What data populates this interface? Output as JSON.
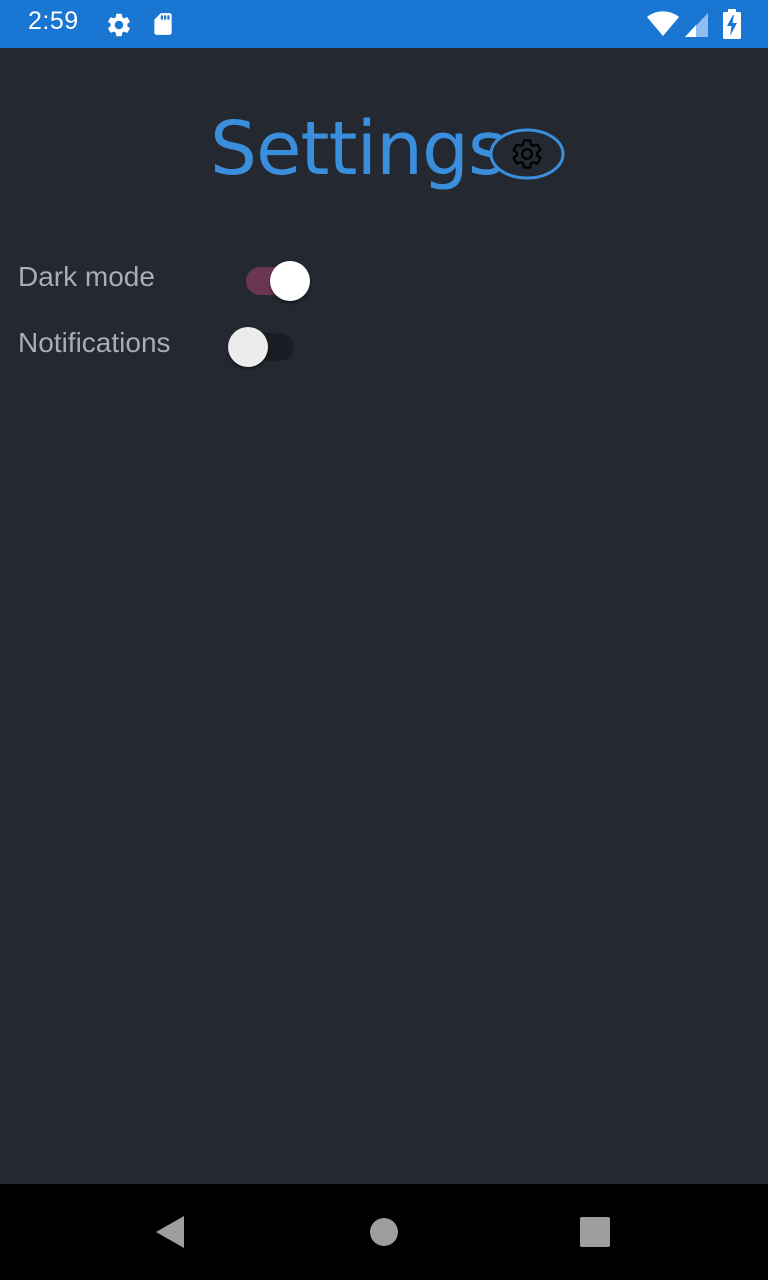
{
  "status_bar": {
    "time": "2:59",
    "icons": [
      "settings-gear-icon",
      "sd-card-icon",
      "wifi-icon",
      "cell-signal-icon",
      "battery-charging-icon"
    ],
    "background": "#1976d2"
  },
  "header": {
    "title": "Settings",
    "title_color": "#3a8edb",
    "icon": "gear-icon"
  },
  "settings": [
    {
      "label": "Dark mode",
      "enabled": true
    },
    {
      "label": "Notifications",
      "enabled": false
    }
  ],
  "nav_bar": {
    "buttons": [
      "back-icon",
      "home-icon",
      "recents-icon"
    ]
  },
  "colors": {
    "background": "#232831",
    "label": "#a7adb8",
    "switch_on_track": "#6b3554"
  }
}
